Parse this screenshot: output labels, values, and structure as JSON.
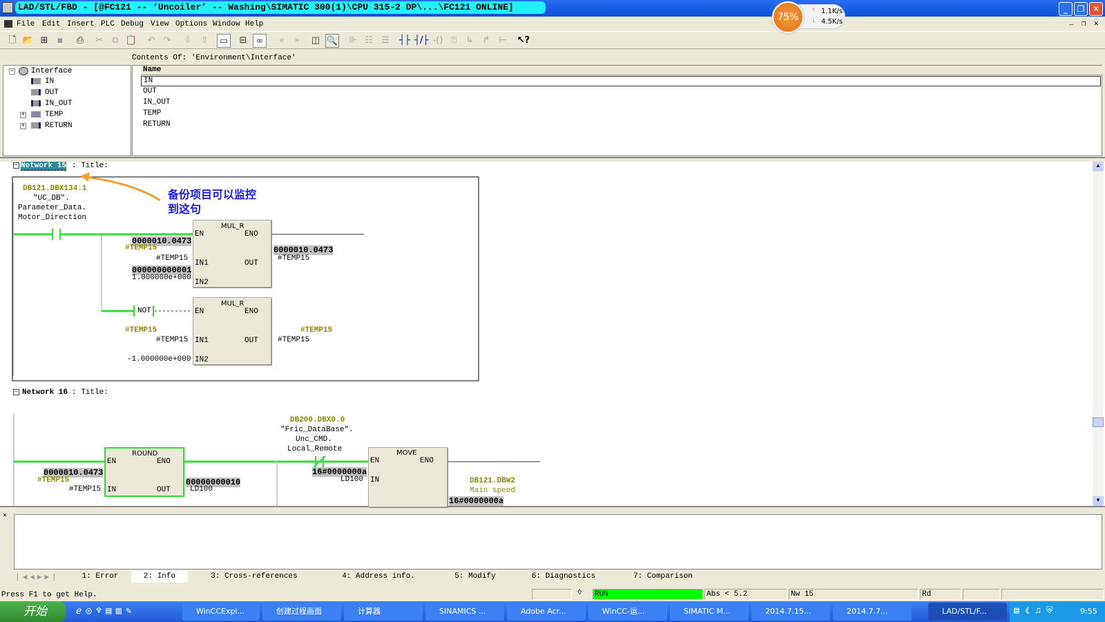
{
  "window": {
    "title": "LAD/STL/FBD  - [@FC121 -- ‘Uncoiler’ -- Washing\\SIMATIC 300(1)\\CPU 315-2 DP\\...\\FC121  ONLINE]"
  },
  "net_widget": {
    "cpu": "75%",
    "up": "1.1K/s",
    "down": "4.5K/s"
  },
  "menu": [
    "File",
    "Edit",
    "Insert",
    "PLC",
    "Debug",
    "View",
    "Options",
    "Window",
    "Help"
  ],
  "interface": {
    "contents_label": "Contents Of: 'Environment\\Interface'",
    "tree": [
      "Interface",
      "IN",
      "OUT",
      "IN_OUT",
      "TEMP",
      "RETURN"
    ],
    "column": "Name",
    "rows": [
      "IN",
      "OUT",
      "IN_OUT",
      "TEMP",
      "RETURN"
    ]
  },
  "network15": {
    "label": "Network 15",
    "title": ": Title:",
    "contact": {
      "address": "DB121.DBX134.1",
      "l1": "\"UC_DB\".",
      "l2": "Parameter_Data.",
      "l3": "Motor_Direction"
    },
    "annotation": {
      "line1": "备份项目可以监控",
      "line2": "到这句"
    },
    "box1": {
      "name": "MUL_R",
      "en": "EN",
      "eno": "ENO",
      "in1": "IN1",
      "in2": "IN2",
      "out": "OUT",
      "in1_value": "0000010.0473",
      "in1_sym": "#TEMP15",
      "in1_var": "#TEMP15",
      "in2_value": "000000000001",
      "in2_const": "1.000000e+000",
      "out_value": "0000010.0473",
      "out_var": "#TEMP15"
    },
    "not_label": "NOT",
    "box2": {
      "name": "MUL_R",
      "en": "EN",
      "eno": "ENO",
      "in1": "IN1",
      "in2": "IN2",
      "out": "OUT",
      "in1_sym": "#TEMP15",
      "in1_var": "#TEMP15",
      "in2_const": "-1.000000e+000",
      "out_sym": "#TEMP15",
      "out_var": "#TEMP15"
    }
  },
  "network16": {
    "label": "Network 16",
    "title": ": Title:",
    "round": {
      "name": "ROUND",
      "en": "EN",
      "eno": "ENO",
      "in": "IN",
      "out": "OUT",
      "in_value": "0000010.0473",
      "in_sym": "#TEMP15",
      "in_var": "#TEMP15",
      "out_value": "00000000010",
      "out_var": "LD100"
    },
    "contact": {
      "address": "DB200.DBX0.0",
      "l1": "\"Fric_DataBase\".",
      "l2": "Unc_CMD.",
      "l3": "Local_Remote"
    },
    "move": {
      "name": "MOVE",
      "en": "EN",
      "eno": "ENO",
      "in": "IN",
      "in_value": "16#0000000a",
      "in_var": "LD100",
      "out_address": "DB121.DBW2",
      "out_comment": "Main speed",
      "out_value": "16#0000000a"
    }
  },
  "tabs": [
    {
      "label": "1: Error"
    },
    {
      "label": "2: Info",
      "active": true
    },
    {
      "label": "3: Cross-references"
    },
    {
      "label": "4: Address info."
    },
    {
      "label": "5: Modify"
    },
    {
      "label": "6: Diagnostics"
    },
    {
      "label": "7: Comparison"
    }
  ],
  "status": {
    "help": "Press F1 to get Help.",
    "mode": "RUN",
    "abs": "Abs < 5.2",
    "nw": "Nw 15",
    "rd": "Rd",
    "run_color": "#00ff00"
  },
  "taskbar": {
    "start": "开始",
    "items": [
      "WinCCExpl...",
      "创建过程画面",
      "计算器",
      "SINAMICS ...",
      "Adobe Acr...",
      "WinCC-运...",
      "SIMATIC M...",
      "2014.7.15...",
      "2014.7.7...",
      "LAD/STL/F..."
    ],
    "clock": "9:55"
  },
  "colors": {
    "title_bg": "#0a4fd8",
    "title_highlight": "#22f0f8",
    "power_flow": "#33dd33",
    "symbol": "#8b8b00",
    "annotation": "#1a1ae6",
    "arrow": "#f0a030"
  }
}
